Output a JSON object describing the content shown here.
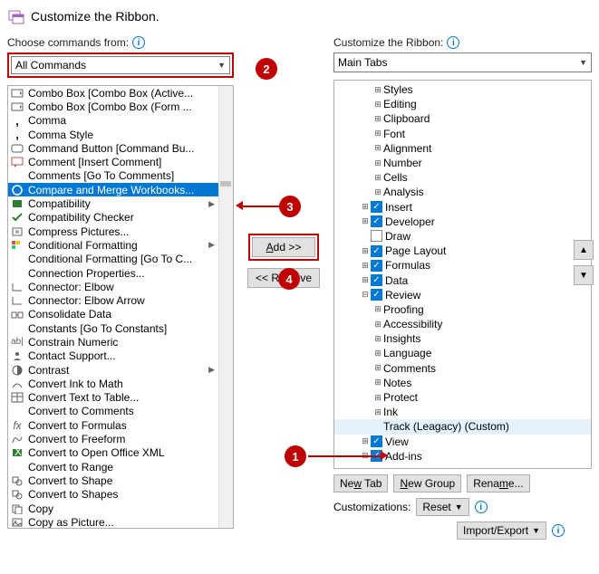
{
  "dialog": {
    "title": "Customize the Ribbon."
  },
  "left": {
    "label": "Choose commands from:",
    "combo_value": "All Commands",
    "commands": [
      {
        "label": "Combo Box [Combo Box (Active...",
        "icon": "combo",
        "sub": ""
      },
      {
        "label": "Combo Box [Combo Box (Form ...",
        "icon": "combo",
        "sub": ""
      },
      {
        "label": "Comma",
        "icon": "comma",
        "sub": ""
      },
      {
        "label": "Comma Style",
        "icon": "comma",
        "sub": ""
      },
      {
        "label": "Command Button [Command Bu...",
        "icon": "button",
        "sub": ""
      },
      {
        "label": "Comment [Insert Comment]",
        "icon": "comment",
        "sub": ""
      },
      {
        "label": "Comments [Go To Comments]",
        "icon": "",
        "sub": ""
      },
      {
        "label": "Compare and Merge Workbooks...",
        "icon": "merge",
        "sub": "",
        "selected": true
      },
      {
        "label": "Compatibility",
        "icon": "compat",
        "sub": "▶"
      },
      {
        "label": "Compatibility Checker",
        "icon": "check",
        "sub": ""
      },
      {
        "label": "Compress Pictures...",
        "icon": "compress",
        "sub": ""
      },
      {
        "label": "Conditional Formatting",
        "icon": "condfmt",
        "sub": "▶"
      },
      {
        "label": "Conditional Formatting [Go To C...",
        "icon": "",
        "sub": ""
      },
      {
        "label": "Connection Properties...",
        "icon": "",
        "sub": ""
      },
      {
        "label": "Connector: Elbow",
        "icon": "conn",
        "sub": ""
      },
      {
        "label": "Connector: Elbow Arrow",
        "icon": "conn",
        "sub": ""
      },
      {
        "label": "Consolidate Data",
        "icon": "consol",
        "sub": ""
      },
      {
        "label": "Constants [Go To Constants]",
        "icon": "",
        "sub": ""
      },
      {
        "label": "Constrain Numeric",
        "icon": "num",
        "sub": ""
      },
      {
        "label": "Contact Support...",
        "icon": "contact",
        "sub": ""
      },
      {
        "label": "Contrast",
        "icon": "contrast",
        "sub": "▶"
      },
      {
        "label": "Convert Ink to Math",
        "icon": "ink",
        "sub": ""
      },
      {
        "label": "Convert Text to Table...",
        "icon": "table",
        "sub": ""
      },
      {
        "label": "Convert to Comments",
        "icon": "",
        "sub": ""
      },
      {
        "label": "Convert to Formulas",
        "icon": "formula",
        "sub": ""
      },
      {
        "label": "Convert to Freeform",
        "icon": "free",
        "sub": ""
      },
      {
        "label": "Convert to Open Office XML",
        "icon": "xml",
        "sub": ""
      },
      {
        "label": "Convert to Range",
        "icon": "",
        "sub": ""
      },
      {
        "label": "Convert to Shape",
        "icon": "shape",
        "sub": ""
      },
      {
        "label": "Convert to Shapes",
        "icon": "shapes",
        "sub": ""
      },
      {
        "label": "Copy",
        "icon": "copy",
        "sub": ""
      },
      {
        "label": "Copy as Picture...",
        "icon": "copypic",
        "sub": ""
      }
    ]
  },
  "buttons": {
    "add": "Add >>",
    "remove": "<< Remove",
    "new_tab": "New Tab",
    "new_group": "New Group",
    "rename": "Rename...",
    "reset": "Reset",
    "import_export": "Import/Export",
    "customizations": "Customizations:"
  },
  "right": {
    "label": "Customize the Ribbon:",
    "combo_value": "Main Tabs",
    "tree": [
      {
        "indent": 3,
        "exp": "⊞",
        "cb": "",
        "label": "Styles"
      },
      {
        "indent": 3,
        "exp": "⊞",
        "cb": "",
        "label": "Editing"
      },
      {
        "indent": 3,
        "exp": "⊞",
        "cb": "",
        "label": "Clipboard"
      },
      {
        "indent": 3,
        "exp": "⊞",
        "cb": "",
        "label": "Font"
      },
      {
        "indent": 3,
        "exp": "⊞",
        "cb": "",
        "label": "Alignment"
      },
      {
        "indent": 3,
        "exp": "⊞",
        "cb": "",
        "label": "Number"
      },
      {
        "indent": 3,
        "exp": "⊞",
        "cb": "",
        "label": "Cells"
      },
      {
        "indent": 3,
        "exp": "⊞",
        "cb": "",
        "label": "Analysis"
      },
      {
        "indent": 2,
        "exp": "⊞",
        "cb": "checked",
        "label": "Insert"
      },
      {
        "indent": 2,
        "exp": "⊞",
        "cb": "checked",
        "label": "Developer"
      },
      {
        "indent": 2,
        "exp": "",
        "cb": "unchecked",
        "label": "Draw"
      },
      {
        "indent": 2,
        "exp": "⊞",
        "cb": "checked",
        "label": "Page Layout"
      },
      {
        "indent": 2,
        "exp": "⊞",
        "cb": "checked",
        "label": "Formulas"
      },
      {
        "indent": 2,
        "exp": "⊞",
        "cb": "checked",
        "label": "Data"
      },
      {
        "indent": 2,
        "exp": "⊟",
        "cb": "checked",
        "label": "Review"
      },
      {
        "indent": 3,
        "exp": "⊞",
        "cb": "",
        "label": "Proofing"
      },
      {
        "indent": 3,
        "exp": "⊞",
        "cb": "",
        "label": "Accessibility"
      },
      {
        "indent": 3,
        "exp": "⊞",
        "cb": "",
        "label": "Insights"
      },
      {
        "indent": 3,
        "exp": "⊞",
        "cb": "",
        "label": "Language"
      },
      {
        "indent": 3,
        "exp": "⊞",
        "cb": "",
        "label": "Comments"
      },
      {
        "indent": 3,
        "exp": "⊞",
        "cb": "",
        "label": "Notes"
      },
      {
        "indent": 3,
        "exp": "⊞",
        "cb": "",
        "label": "Protect"
      },
      {
        "indent": 3,
        "exp": "⊞",
        "cb": "",
        "label": "Ink"
      },
      {
        "indent": 3,
        "exp": "",
        "cb": "",
        "label": "Track (Leagacy) (Custom)",
        "selected": true
      },
      {
        "indent": 2,
        "exp": "⊞",
        "cb": "checked",
        "label": "View"
      },
      {
        "indent": 2,
        "exp": "⊞",
        "cb": "checked",
        "label": "Add-ins"
      }
    ]
  },
  "callouts": {
    "1": "1",
    "2": "2",
    "3": "3",
    "4": "4"
  }
}
